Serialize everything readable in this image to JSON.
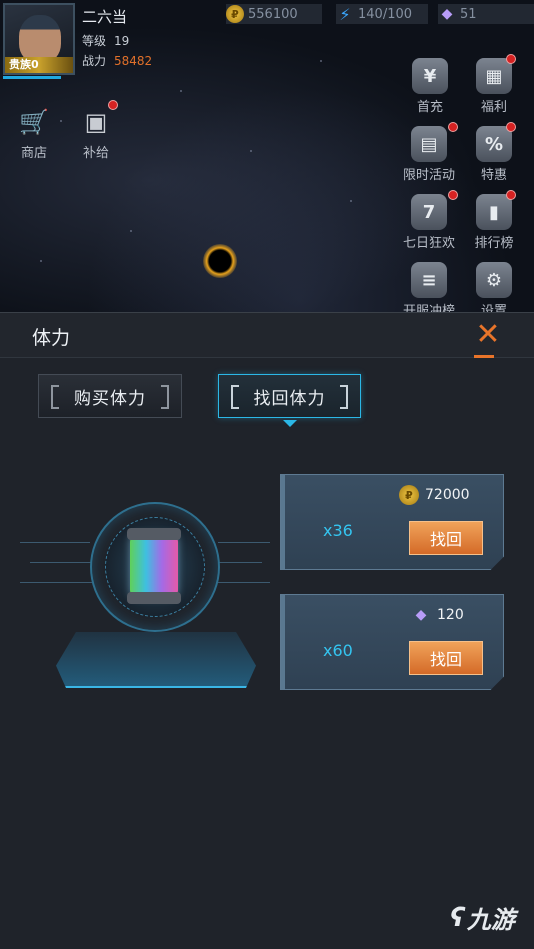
{
  "player": {
    "name": "二六当",
    "level_label": "等级",
    "level": "19",
    "power_label": "战力",
    "power": "58482",
    "vip": "贵族0"
  },
  "resources": [
    {
      "icon": "gold-coin-icon",
      "value": "556100"
    },
    {
      "icon": "stamina-bolt-icon",
      "value": "140/100"
    },
    {
      "icon": "crystal-icon",
      "value": "51"
    }
  ],
  "left_icons": [
    {
      "label": "商店",
      "icon": "shop-cart-icon"
    },
    {
      "label": "补给",
      "icon": "supply-box-icon"
    }
  ],
  "right_icons": [
    {
      "label": "首充",
      "icon": "first-recharge-icon"
    },
    {
      "label": "福利",
      "icon": "gift-icon"
    },
    {
      "label": "限时活动",
      "icon": "calendar-icon"
    },
    {
      "label": "特惠",
      "icon": "discount-icon"
    },
    {
      "label": "七日狂欢",
      "icon": "seven-day-icon"
    },
    {
      "label": "排行榜",
      "icon": "ranking-icon"
    },
    {
      "label": "开服冲榜",
      "icon": "server-race-icon"
    },
    {
      "label": "设置",
      "icon": "gear-icon"
    }
  ],
  "panel": {
    "title": "体力",
    "tabs": [
      {
        "label": "购买体力",
        "active": false
      },
      {
        "label": "找回体力",
        "active": true
      }
    ],
    "offers": [
      {
        "quantity": "x36",
        "cost_icon": "gold-coin-icon",
        "cost": "72000",
        "button": "找回"
      },
      {
        "quantity": "x60",
        "cost_icon": "crystal-icon",
        "cost": "120",
        "button": "找回"
      }
    ]
  },
  "watermark": {
    "text": "九游"
  },
  "colors": {
    "accent_blue": "#2bb7e6",
    "accent_orange": "#e8742a",
    "power_orange": "#e0702a"
  }
}
